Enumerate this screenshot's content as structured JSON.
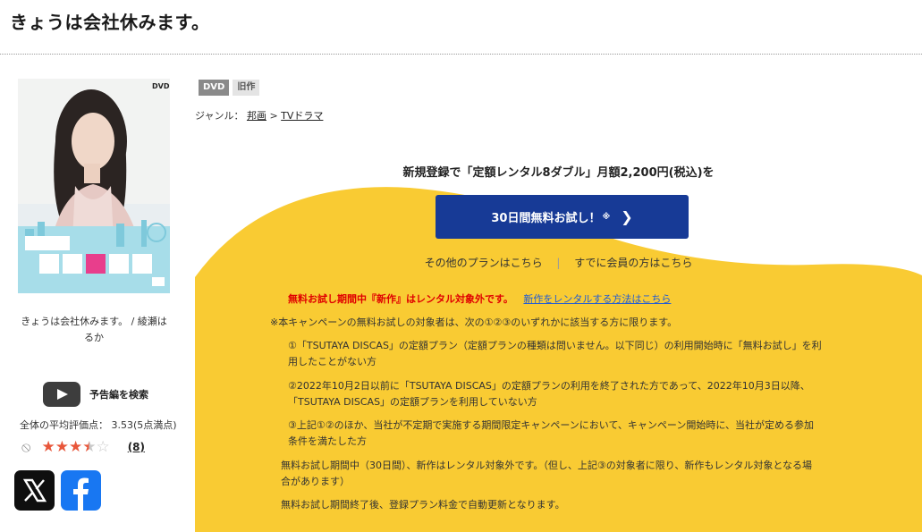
{
  "page_title": "きょうは会社休みます。",
  "item": {
    "caption": "きょうは会社休みます。 / 綾瀬はるか",
    "trailer_label": "予告編を検索",
    "avg_rating_text": "全体の平均評価点： 3.53(5点満点)",
    "rating_value": 3.53,
    "review_count": "(8)"
  },
  "badges": {
    "dvd": "DVD",
    "old": "旧作"
  },
  "genre": {
    "label": "ジャンル：",
    "first": "邦画",
    "sep": ">",
    "second": "TVドラマ"
  },
  "promo": {
    "line": "新規登録で「定額レンタル8ダブル」月額2,200円(税込)を",
    "cta_label": "30日間無料お試し！",
    "cta_note": "※",
    "other_plans": "その他のプランはこちら",
    "separator": "|",
    "member_link": "すでに会員の方はこちら"
  },
  "notice": {
    "red": "無料お試し期間中『新作』はレンタル対象外です。",
    "blue_link": "新作をレンタルする方法はこちら",
    "intro": "※本キャンペーンの無料お試しの対象者は、次の①②③のいずれかに該当する方に限ります。",
    "c1_line1": "①「TSUTAYA DISCAS」の定額プラン（定額プランの種類は問いません。以下同じ）の利用開始時に「無料お試し」を利",
    "c1_line2": "用したことがない方",
    "c2_line1": "②2022年10月2日以前に「TSUTAYA DISCAS」の定額プランの利用を終了された方であって、2022年10月3日以降、",
    "c2_line2": "「TSUTAYA DISCAS」の定額プランを利用していない方",
    "c3_line1": "③上記①②のほか、当社が不定期で実施する期間限定キャンペーンにおいて、キャンペーン開始時に、当社が定める参加",
    "c3_line2": "条件を満たした方",
    "p1_line1": "無料お試し期間中（30日間）、新作はレンタル対象外です。（但し、上記③の対象者に限り、新作もレンタル対象となる場",
    "p1_line2": "合があります）",
    "p2": "無料お試し期間終了後、登録プラン料金で自動更新となります。"
  },
  "colors": {
    "yellow": "#f9cb33",
    "cta_blue": "#173a96",
    "red_text": "#e00000",
    "link_blue": "#1f5bd6",
    "star": "#e8563a"
  },
  "icons": [
    "youtube-play-icon",
    "no-entry-icon",
    "star-icon",
    "x-logo-icon",
    "facebook-logo-icon",
    "chevron-right-icon"
  ]
}
